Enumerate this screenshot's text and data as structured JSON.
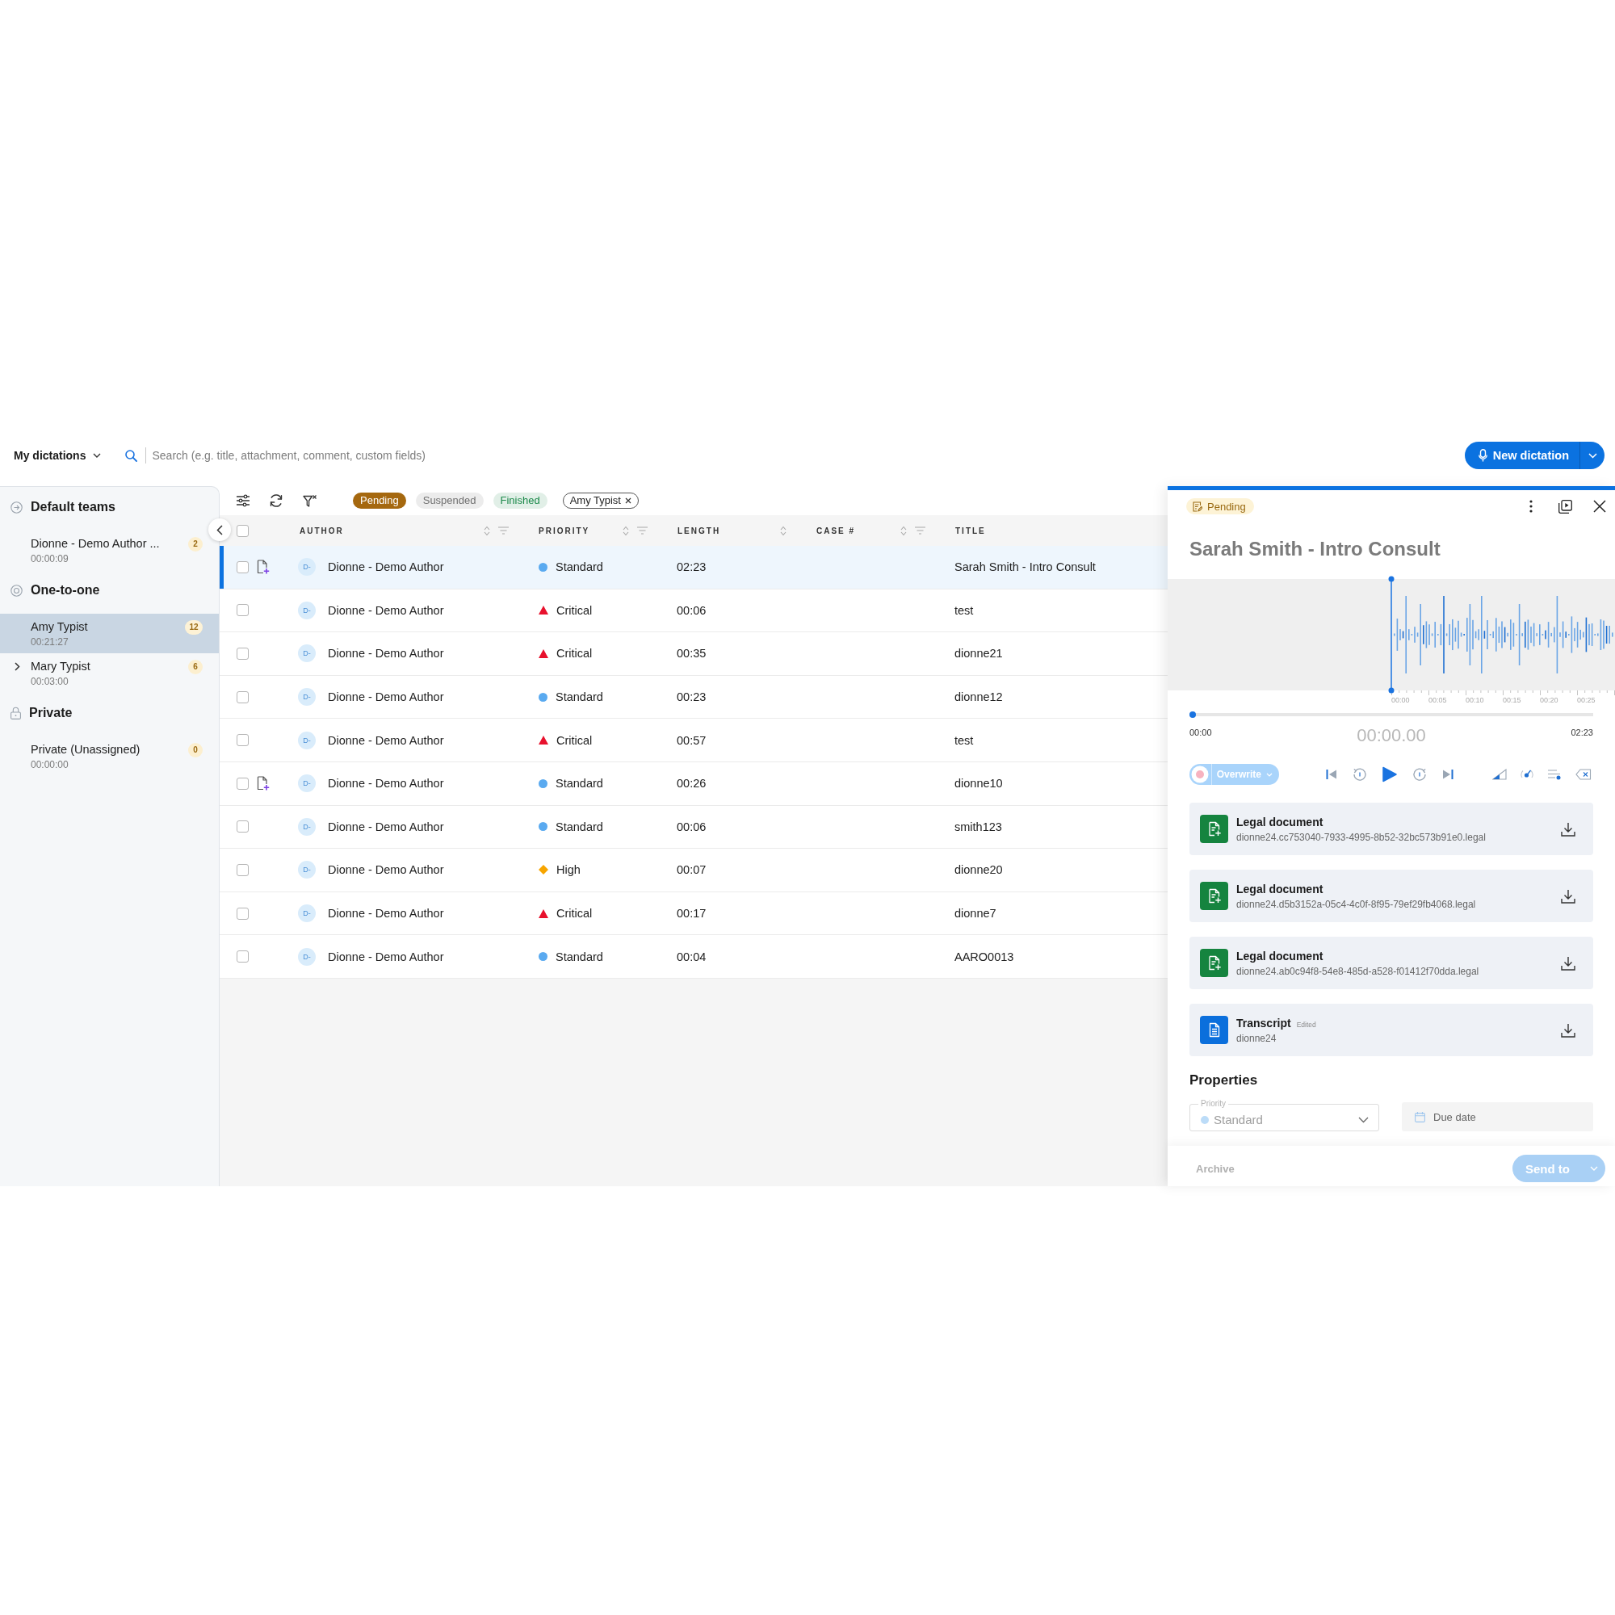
{
  "top_bar": {
    "view_selector": "My dictations",
    "search": {
      "placeholder": "Search (e.g. title, attachment, comment, custom fields)"
    },
    "new_button": "New dictation"
  },
  "sidebar": {
    "groups": [
      {
        "kind": "teams",
        "title": "Default teams",
        "items": [
          {
            "name": "Dionne - Demo Author ...",
            "duration": "00:00:09",
            "count": "2",
            "selected": false,
            "has_subitems": false
          }
        ]
      },
      {
        "kind": "one_to_one",
        "title": "One-to-one",
        "items": [
          {
            "name": "Amy Typist",
            "duration": "00:21:27",
            "count": "12",
            "selected": true,
            "has_subitems": false
          },
          {
            "name": "Mary Typist",
            "duration": "00:03:00",
            "count": "6",
            "selected": false,
            "has_subitems": true
          }
        ]
      },
      {
        "kind": "private",
        "title": "Private",
        "items": [
          {
            "name": "Private (Unassigned)",
            "duration": "00:00:00",
            "count": "0",
            "selected": false,
            "has_subitems": false
          }
        ]
      }
    ]
  },
  "toolbar": {
    "status_filters": [
      {
        "label": "Pending",
        "selected": true,
        "color": "#a5680f"
      },
      {
        "label": "Suspended",
        "selected": false,
        "color": "#707070"
      },
      {
        "label": "Finished",
        "selected": false,
        "color": "#1d8a4b"
      }
    ],
    "assignee_filter": {
      "label": "Amy Typist"
    }
  },
  "table": {
    "select_all": {
      "checked": false
    },
    "columns": [
      {
        "label": "AUTHOR",
        "sortable": true,
        "filterable": true
      },
      {
        "label": "PRIORITY",
        "sortable": true,
        "filterable": true
      },
      {
        "label": "LENGTH",
        "sortable": true,
        "filterable": false
      },
      {
        "label": "CASE #",
        "sortable": true,
        "filterable": true
      },
      {
        "label": "TITLE",
        "sortable": false,
        "filterable": false
      }
    ],
    "rows": [
      {
        "checked": false,
        "has_document": true,
        "initials": "D-",
        "author": "Dionne - Demo Author",
        "priority": {
          "label": "Standard",
          "kind": "standard"
        },
        "length": "02:23",
        "title": "Sarah Smith - Intro Consult",
        "selected": true
      },
      {
        "checked": false,
        "has_document": false,
        "initials": "D-",
        "author": "Dionne - Demo Author",
        "priority": {
          "label": "Critical",
          "kind": "critical"
        },
        "length": "00:06",
        "title": "test",
        "selected": false
      },
      {
        "checked": false,
        "has_document": false,
        "initials": "D-",
        "author": "Dionne - Demo Author",
        "priority": {
          "label": "Critical",
          "kind": "critical"
        },
        "length": "00:35",
        "title": "dionne21",
        "selected": false
      },
      {
        "checked": false,
        "has_document": false,
        "initials": "D-",
        "author": "Dionne - Demo Author",
        "priority": {
          "label": "Standard",
          "kind": "standard"
        },
        "length": "00:23",
        "title": "dionne12",
        "selected": false
      },
      {
        "checked": false,
        "has_document": false,
        "initials": "D-",
        "author": "Dionne - Demo Author",
        "priority": {
          "label": "Critical",
          "kind": "critical"
        },
        "length": "00:57",
        "title": "test",
        "selected": false
      },
      {
        "checked": false,
        "has_document": true,
        "initials": "D-",
        "author": "Dionne - Demo Author",
        "priority": {
          "label": "Standard",
          "kind": "standard"
        },
        "length": "00:26",
        "title": "dionne10",
        "selected": false
      },
      {
        "checked": false,
        "has_document": false,
        "initials": "D-",
        "author": "Dionne - Demo Author",
        "priority": {
          "label": "Standard",
          "kind": "standard"
        },
        "length": "00:06",
        "title": "smith123",
        "selected": false
      },
      {
        "checked": false,
        "has_document": false,
        "initials": "D-",
        "author": "Dionne - Demo Author",
        "priority": {
          "label": "High",
          "kind": "high"
        },
        "length": "00:07",
        "title": "dionne20",
        "selected": false
      },
      {
        "checked": false,
        "has_document": false,
        "initials": "D-",
        "author": "Dionne - Demo Author",
        "priority": {
          "label": "Critical",
          "kind": "critical"
        },
        "length": "00:17",
        "title": "dionne7",
        "selected": false
      },
      {
        "checked": false,
        "has_document": false,
        "initials": "D-",
        "author": "Dionne - Demo Author",
        "priority": {
          "label": "Standard",
          "kind": "standard"
        },
        "length": "00:04",
        "title": "AARO0013",
        "selected": false
      }
    ]
  },
  "detail_panel": {
    "status": "Pending",
    "title": "Sarah Smith - Intro Consult",
    "timeline_labels": [
      "00:00",
      "00:05",
      "00:10",
      "00:15",
      "00:20",
      "00:25"
    ],
    "progress": {
      "level": 0,
      "start": "00:00",
      "end": "02:23"
    },
    "current_time": "00:00.00",
    "record_mode": {
      "label": "Overwrite"
    },
    "attachments": [
      {
        "kind": "legal",
        "title": "Legal document",
        "file": "dionne24.cc753040-7933-4995-8b52-32bc573b91e0.legal"
      },
      {
        "kind": "legal",
        "title": "Legal document",
        "file": "dionne24.d5b3152a-05c4-4c0f-8f95-79ef29fb4068.legal"
      },
      {
        "kind": "legal",
        "title": "Legal document",
        "file": "dionne24.ab0c94f8-54e8-485d-a528-f01412f70dda.legal"
      },
      {
        "kind": "transcript",
        "title": "Transcript",
        "tag": "Edited",
        "file": "dionne24"
      }
    ],
    "properties": {
      "heading": "Properties",
      "priority": {
        "label": "Priority",
        "value": "Standard",
        "kind": "standard",
        "disabled": true
      },
      "due_date": {
        "placeholder": "Due date"
      }
    },
    "footer": {
      "archive": {
        "label": "Archive",
        "disabled": true
      },
      "send": {
        "label": "Send to",
        "disabled": true
      }
    }
  }
}
